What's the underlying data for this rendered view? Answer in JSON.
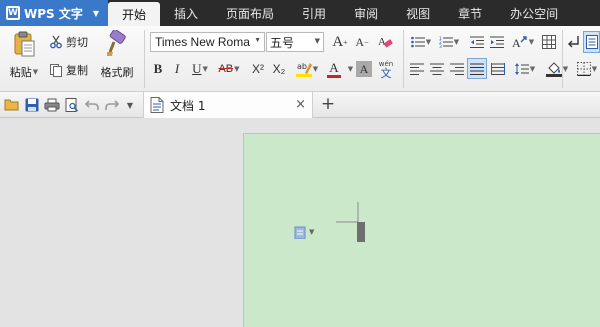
{
  "app": {
    "name": "WPS 文字"
  },
  "menu": {
    "tabs": [
      "开始",
      "插入",
      "页面布局",
      "引用",
      "审阅",
      "视图",
      "章节",
      "办公空间"
    ],
    "active_index": 0
  },
  "ribbon": {
    "clipboard": {
      "paste": "粘贴",
      "cut": "剪切",
      "copy": "复制",
      "format_painter": "格式刷"
    },
    "font": {
      "family": "Times New Roma",
      "size": "五号"
    },
    "glyphs": {
      "bold": "B",
      "italic": "I",
      "underline": "U",
      "strikethrough": "AB",
      "superscript": "X²",
      "subscript": "X₂",
      "font_color": "A",
      "char_shading": "A",
      "grow": "A",
      "shrink": "A",
      "phonetic_top": "wén",
      "phonetic_bottom": "文"
    }
  },
  "tabs": {
    "document": "文档 1",
    "close_glyph": "×",
    "new_tab_glyph": "+"
  },
  "colors": {
    "app_blue": "#3a78c9",
    "page_green": "#cbe8cb",
    "font_red": "#cc2222",
    "highlight_yellow": "#ffe200"
  }
}
